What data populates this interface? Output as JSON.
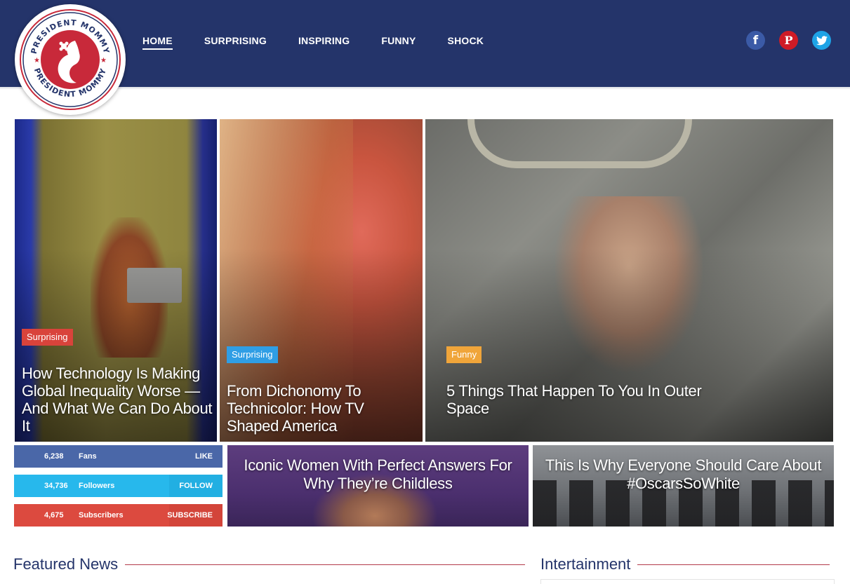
{
  "header": {
    "logo_text": "PRESIDENT MOMMY",
    "nav": [
      {
        "label": "HOME",
        "active": true
      },
      {
        "label": "SURPRISING",
        "active": false
      },
      {
        "label": "INSPIRING",
        "active": false
      },
      {
        "label": "FUNNY",
        "active": false
      },
      {
        "label": "SHOCK",
        "active": false
      }
    ],
    "social_icons": [
      "facebook-icon",
      "pinterest-icon",
      "twitter-icon"
    ]
  },
  "tiles": [
    {
      "category": "Surprising",
      "title": "How Technology Is Making Global Inequality Worse — And What We Can Do About It"
    },
    {
      "category": "Surprising",
      "title": "From Dichonomy To Technicolor: How TV Shaped America"
    },
    {
      "category": "Funny",
      "title": "5 Things That Happen To You In Outer Space"
    },
    {
      "title": "Iconic Women With Perfect Answers For Why They’re Childless"
    },
    {
      "title": "This Is Why Everyone Should Care About #OscarsSoWhite"
    }
  ],
  "counters": [
    {
      "network": "facebook",
      "count": "6,238",
      "label": "Fans",
      "action": "LIKE"
    },
    {
      "network": "twitter",
      "count": "34,736",
      "label": "Followers",
      "action": "FOLLOW"
    },
    {
      "network": "youtube",
      "count": "4,675",
      "label": "Subscribers",
      "action": "SUBSCRIBE"
    }
  ],
  "sections": {
    "featured": "Featured News",
    "entertainment": "Intertainment"
  },
  "colors": {
    "header_bg": "#24346a",
    "accent_red": "#d9433b",
    "badge_blue": "#2f9ee5",
    "badge_orange": "#f0a53a"
  }
}
